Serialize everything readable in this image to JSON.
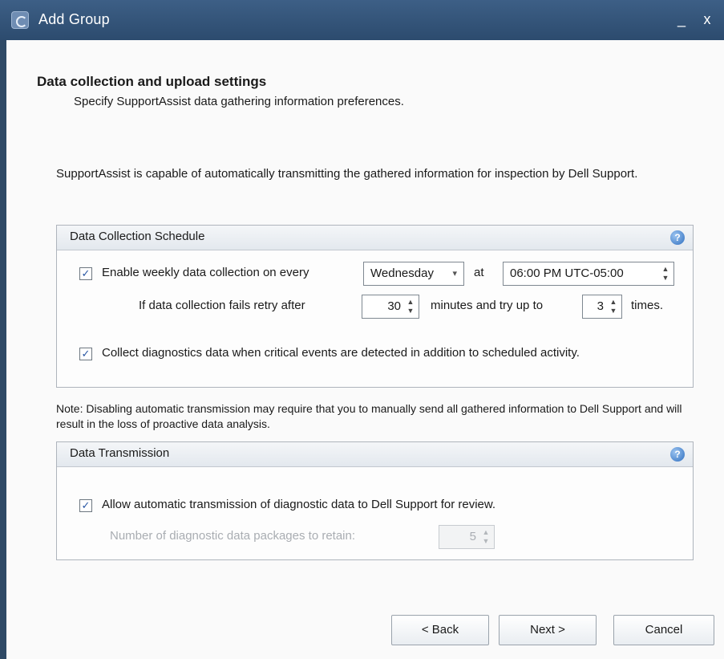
{
  "window": {
    "title": "Add Group",
    "minimize_glyph": "_",
    "close_glyph": "x"
  },
  "header": {
    "title": "Data collection and upload settings",
    "subtitle": "Specify SupportAssist data gathering information preferences."
  },
  "intro_text": "SupportAssist is capable of automatically transmitting the gathered information for inspection by Dell Support.",
  "schedule": {
    "title": "Data Collection Schedule",
    "enable_weekly": {
      "checked": true,
      "label": "Enable weekly data collection on every",
      "day": "Wednesday",
      "at_label": "at",
      "time": "06:00 PM UTC-05:00"
    },
    "retry": {
      "label_before": "If data collection fails retry after",
      "minutes": "30",
      "label_middle": "minutes and try up to",
      "times": "3",
      "label_after": "times."
    },
    "critical": {
      "checked": true,
      "label": "Collect diagnostics data when critical events are detected in addition to scheduled activity."
    }
  },
  "note_text": "Note:  Disabling automatic transmission may require that you to manually send all gathered information to Dell Support and will result in the loss of proactive data analysis.",
  "transmission": {
    "title": "Data Transmission",
    "allow": {
      "checked": true,
      "label": "Allow automatic transmission of diagnostic data to Dell Support for review."
    },
    "retain": {
      "label": "Number of diagnostic data packages to retain:",
      "value": "5",
      "disabled": true
    }
  },
  "buttons": {
    "back": "< Back",
    "next": "Next >",
    "cancel": "Cancel"
  },
  "icons": {
    "check": "✓",
    "help": "?",
    "dropdown": "▾",
    "spin_up": "▲",
    "spin_down": "▼"
  }
}
